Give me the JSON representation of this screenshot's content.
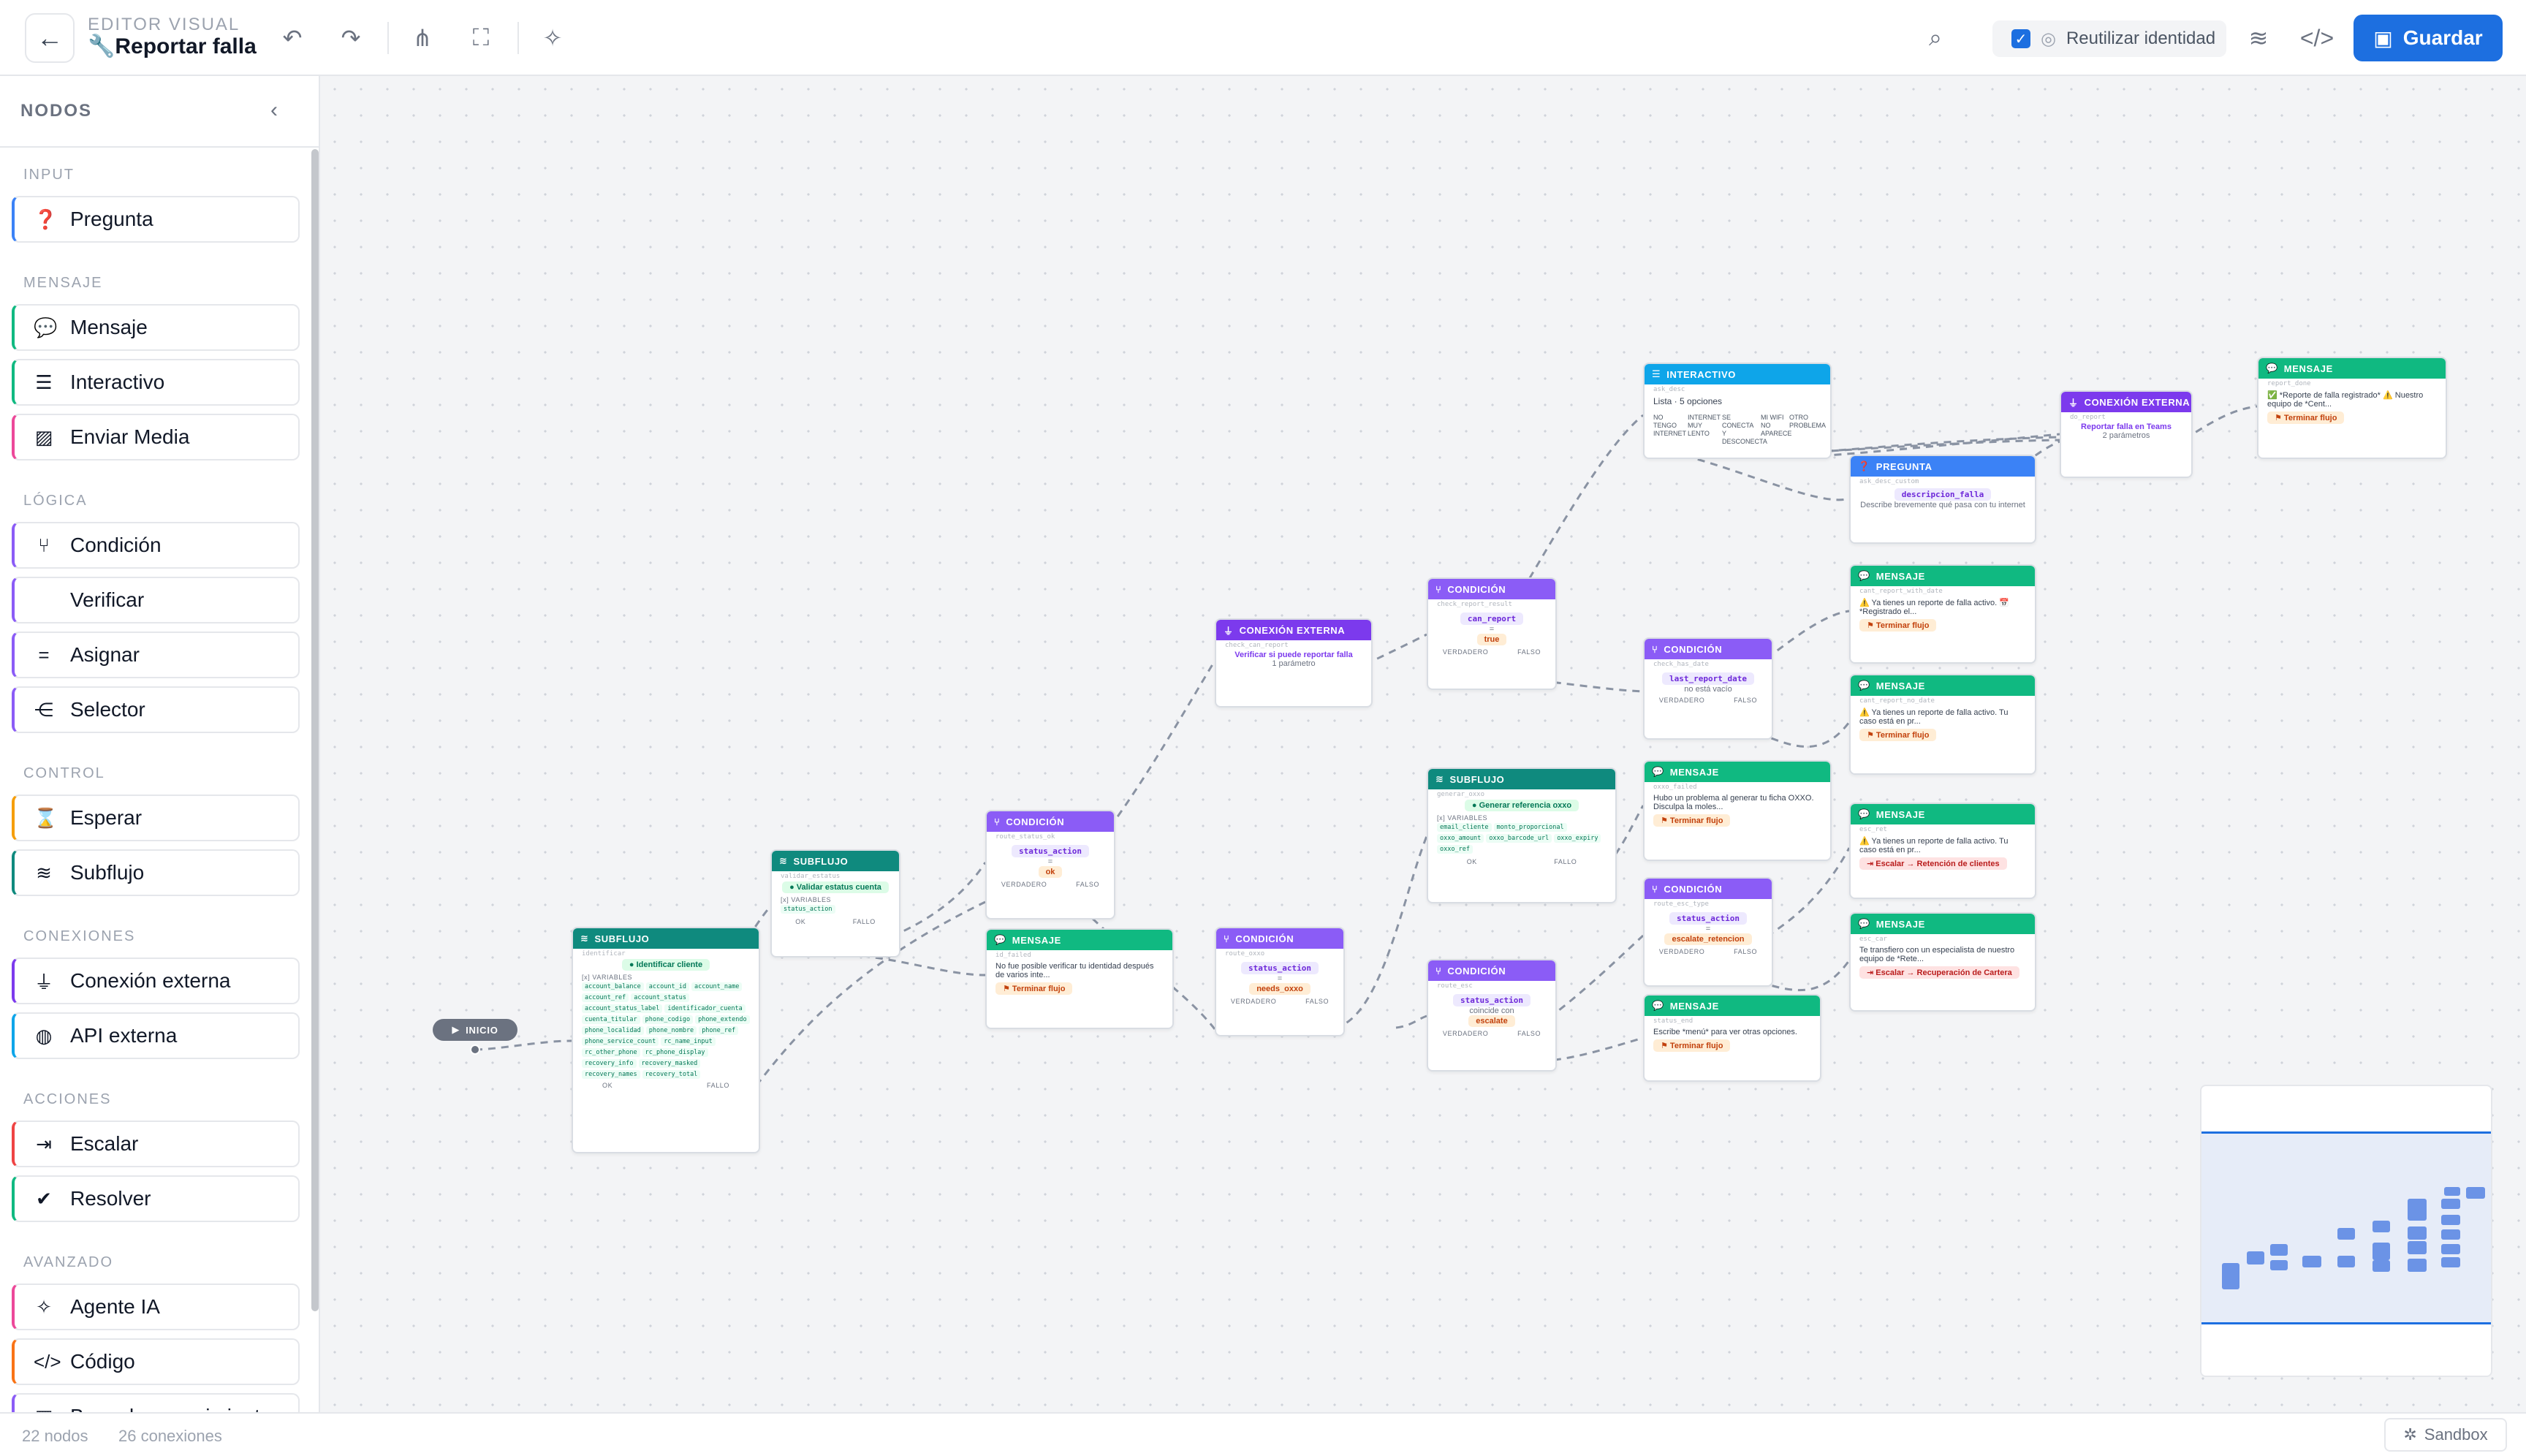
{
  "header": {
    "eyebrow": "EDITOR VISUAL",
    "title_icon": "🔧",
    "title": "Reportar falla",
    "reuse_label": "Reutilizar identidad",
    "save_label": "Guardar"
  },
  "sidebar": {
    "title": "NODOS",
    "categories": [
      "INPUT",
      "MENSAJE",
      "LÓGICA",
      "CONTROL",
      "CONEXIONES",
      "ACCIONES",
      "AVANZADO"
    ],
    "items": [
      {
        "label": "Pregunta",
        "icon": "question-circle-icon",
        "accent": "#3b82f6"
      },
      {
        "label": "Mensaje",
        "icon": "chat-bubble-icon",
        "accent": "#10b981"
      },
      {
        "label": "Interactivo",
        "icon": "list-icon",
        "accent": "#10b981"
      },
      {
        "label": "Enviar Media",
        "icon": "image-icon",
        "accent": "#ec4899"
      },
      {
        "label": "Condición",
        "icon": "branch-icon",
        "accent": "#8b5cf6"
      },
      {
        "label": "Verificar",
        "icon": "check-icon",
        "accent": "#8b5cf6"
      },
      {
        "label": "Asignar",
        "icon": "equals-icon",
        "accent": "#8b5cf6"
      },
      {
        "label": "Selector",
        "icon": "split-icon",
        "accent": "#8b5cf6"
      },
      {
        "label": "Esperar",
        "icon": "hourglass-icon",
        "accent": "#f59e0b"
      },
      {
        "label": "Subflujo",
        "icon": "layers-icon",
        "accent": "#0f8a7e"
      },
      {
        "label": "Conexión externa",
        "icon": "plug-icon",
        "accent": "#7c3aed"
      },
      {
        "label": "API externa",
        "icon": "globe-icon",
        "accent": "#0ea5e9"
      },
      {
        "label": "Escalar",
        "icon": "exit-arrow-icon",
        "accent": "#ef4444"
      },
      {
        "label": "Resolver",
        "icon": "check-circle-icon",
        "accent": "#10b981"
      },
      {
        "label": "Agente IA",
        "icon": "magic-wand-icon",
        "accent": "#ec4899"
      },
      {
        "label": "Código",
        "icon": "code-icon",
        "accent": "#f97316"
      },
      {
        "label": "Base de conocimiento",
        "icon": "book-icon",
        "accent": "#8b5cf6"
      }
    ]
  },
  "footer": {
    "nodes_count": "22 nodos",
    "connections_count": "26 conexiones",
    "sandbox_label": "Sandbox"
  },
  "canvas": {
    "start_label": "INICIO",
    "port_ok": "OK",
    "port_fail": "FALLO",
    "port_true": "VERDADERO",
    "port_false": "FALSO",
    "vars_heading": "VARIABLES",
    "end_flow": "Terminar flujo",
    "n_subflow1": {
      "type": "SUBFLUJO",
      "id": "identificar",
      "pill": "Identificar cliente",
      "tags": [
        "account_balance",
        "account_id",
        "account_name",
        "account_ref",
        "account_status",
        "account_status_label",
        "identificador_cuenta",
        "cuenta_titular",
        "phone_codigo",
        "phone_extendo",
        "phone_localidad",
        "phone_nombre",
        "phone_ref",
        "phone_service_count",
        "rc_name_input",
        "rc_other_phone",
        "rc_phone_display",
        "recovery_info",
        "recovery_masked",
        "recovery_names",
        "recovery_total"
      ]
    },
    "n_subflow2": {
      "type": "SUBFLUJO",
      "id": "validar_estatus",
      "pill": "Validar estatus cuenta",
      "tags": [
        "status_action"
      ]
    },
    "n_cond1": {
      "type": "CONDICIÓN",
      "id": "route_status_ok",
      "var": "status_action",
      "op": "=",
      "val": "ok"
    },
    "n_msg1": {
      "type": "MENSAJE",
      "id": "id_failed",
      "text": "No fue posible verificar tu identidad después de varios inte..."
    },
    "n_ext1": {
      "type": "CONEXIÓN EXTERNA",
      "id": "check_can_report",
      "title": "Verificar si puede reportar falla",
      "sub": "1 parámetro"
    },
    "n_cond2": {
      "type": "CONDICIÓN",
      "id": "route_oxxo",
      "var": "status_action",
      "op": "=",
      "val": "needs_oxxo"
    },
    "n_cond3": {
      "type": "CONDICIÓN",
      "id": "check_report_result",
      "var": "can_report",
      "op": "=",
      "val": "true"
    },
    "n_subflow3": {
      "type": "SUBFLUJO",
      "id": "generar_oxxo",
      "pill": "Generar referencia oxxo",
      "tags": [
        "email_cliente",
        "monto_proporcional",
        "oxxo_amount",
        "oxxo_barcode_url",
        "oxxo_expiry",
        "oxxo_ref"
      ]
    },
    "n_cond4": {
      "type": "CONDICIÓN",
      "id": "route_esc",
      "var": "status_action",
      "op": "coincide con",
      "val": "escalate"
    },
    "n_inter": {
      "type": "INTERACTIVO",
      "id": "ask_desc",
      "text": "Lista · 5 opciones",
      "options": [
        "NO TENGO INTERNET",
        "INTERNET MUY LENTO",
        "SE CONECTA Y DESCONECTA",
        "MI WIFI NO APARECE",
        "OTRO PROBLEMA"
      ]
    },
    "n_cond5": {
      "type": "CONDICIÓN",
      "id": "check_has_date",
      "var": "last_report_date",
      "op": "no está vacío"
    },
    "n_msg2": {
      "type": "MENSAJE",
      "id": "oxxo_failed",
      "text": "Hubo un problema al generar tu ficha OXXO. Disculpa la moles..."
    },
    "n_cond6": {
      "type": "CONDICIÓN",
      "id": "route_esc_type",
      "var": "status_action",
      "op": "=",
      "val": "escalate_retencion"
    },
    "n_msg3": {
      "type": "MENSAJE",
      "id": "status_end",
      "text": "Escribe *menú* para ver otras opciones."
    },
    "n_pregunta": {
      "type": "PREGUNTA",
      "id": "ask_desc_custom",
      "var": "descripcion_falla",
      "text": "Describe brevemente qué pasa con tu internet"
    },
    "n_msg4": {
      "type": "MENSAJE",
      "id": "cant_report_with_date",
      "text": "⚠️ Ya tienes un reporte de falla activo. 📅 *Registrado el..."
    },
    "n_msg5": {
      "type": "MENSAJE",
      "id": "cant_report_no_date",
      "text": "⚠️ Ya tienes un reporte de falla activo. Tu caso está en pr..."
    },
    "n_msg6": {
      "type": "MENSAJE",
      "id": "esc_ret",
      "text": "⚠️ Ya tienes un reporte de falla activo. Tu caso está en pr...",
      "badge": "Escalar → Retención de clientes"
    },
    "n_msg7": {
      "type": "MENSAJE",
      "id": "esc_car",
      "text": "Te transfiero con un especialista de nuestro equipo de *Rete...",
      "badge": "Escalar → Recuperación de Cartera"
    },
    "n_ext2": {
      "type": "CONEXIÓN EXTERNA",
      "id": "do_report",
      "title": "Reportar falla en Teams",
      "sub": "2 parámetros"
    },
    "n_msg8": {
      "type": "MENSAJE",
      "id": "report_done",
      "text": "✅ *Reporte de falla registrado* ⚠️ Nuestro equipo de *Cent..."
    }
  }
}
